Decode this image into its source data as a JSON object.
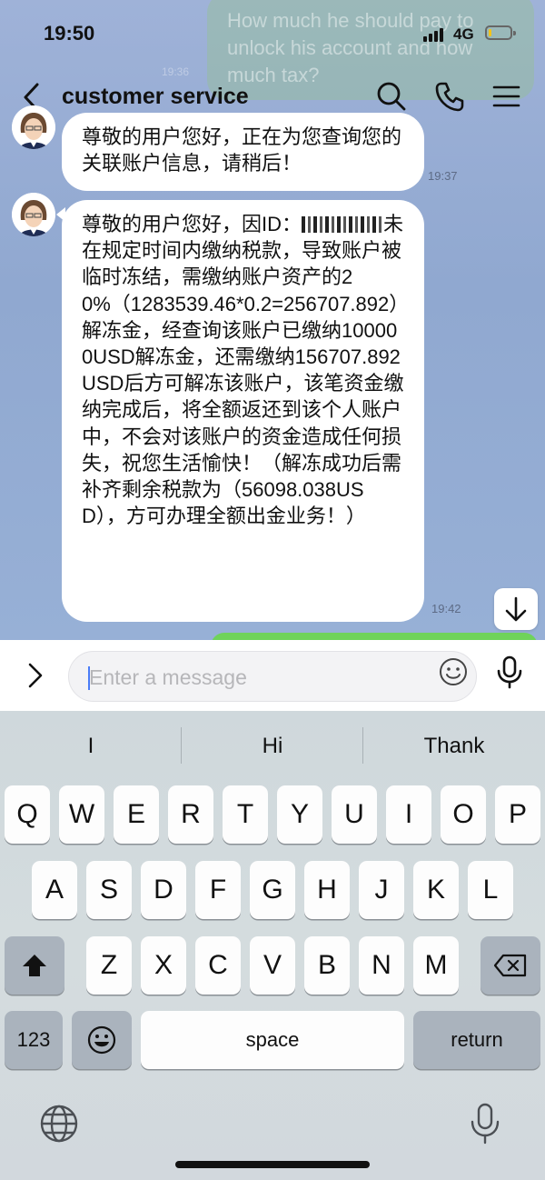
{
  "status_bar": {
    "time": "19:50",
    "network": "4G",
    "battery_level": 0.12
  },
  "header": {
    "title": "customer service",
    "icons": [
      "back-chevron-icon",
      "search-icon",
      "phone-icon",
      "menu-icon"
    ]
  },
  "background_message": {
    "text": "How much he should pay to unlock his account and how much tax?",
    "time": "19:36"
  },
  "messages": [
    {
      "sender": "agent",
      "text": "尊敬的用户您好，正在为您查询您的关联账户信息，请稍后！",
      "time": "19:37"
    },
    {
      "sender": "agent",
      "text_before_id": "尊敬的用户您好，因ID：",
      "text_after_id": "未在规定时间内缴纳税款，导致账户被临时冻结，需缴纳账户资产的20%（1283539.46*0.2=256707.892）解冻金，经查询该账户已缴纳100000USD解冻金，还需缴纳156707.892USD后方可解冻该账户，该笔资金缴纳完成后，将全额返还到该个人账户中，不会对该账户的资金造成任何损失，祝您生活愉快！（解冻成功后需补齐剩余税款为（56098.038USD），方可办理全额出金业务！）",
      "time": "19:42"
    }
  ],
  "input": {
    "placeholder": "Enter a message",
    "value": ""
  },
  "keyboard": {
    "suggestions": [
      "I",
      "Hi",
      "Thank"
    ],
    "row1": [
      "Q",
      "W",
      "E",
      "R",
      "T",
      "Y",
      "U",
      "I",
      "O",
      "P"
    ],
    "row2": [
      "A",
      "S",
      "D",
      "F",
      "G",
      "H",
      "J",
      "K",
      "L"
    ],
    "row3": [
      "Z",
      "X",
      "C",
      "V",
      "B",
      "N",
      "M"
    ],
    "numbers_label": "123",
    "space_label": "space",
    "return_label": "return"
  },
  "colors": {
    "chat_background": "#90a8d0",
    "bubble": "#ffffff",
    "sent_bubble": "#6fd35a",
    "caret": "#4a7cf7",
    "battery": "#f3c318"
  }
}
